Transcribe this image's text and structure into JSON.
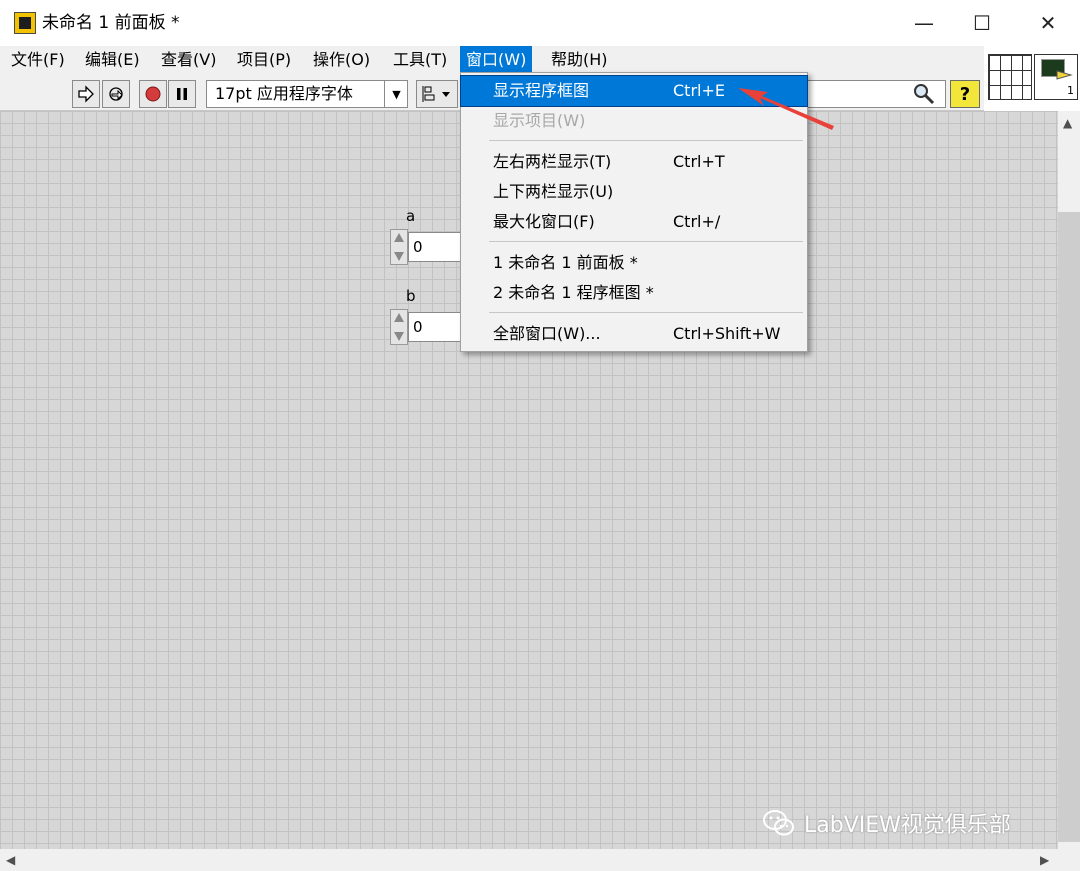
{
  "window": {
    "title": "未命名 1 前面板 *",
    "minimize_glyph": "—",
    "maximize_glyph": "☐",
    "close_glyph": "✕"
  },
  "menubar": {
    "items": [
      {
        "label": "文件(F)"
      },
      {
        "label": "编辑(E)"
      },
      {
        "label": "查看(V)"
      },
      {
        "label": "项目(P)"
      },
      {
        "label": "操作(O)"
      },
      {
        "label": "工具(T)"
      },
      {
        "label": "窗口(W)",
        "active": true
      },
      {
        "label": "帮助(H)"
      }
    ]
  },
  "toolbar": {
    "font_label": "17pt 应用程序字体",
    "help_glyph": "?"
  },
  "window_menu": {
    "items": [
      {
        "label": "显示程序框图",
        "shortcut": "Ctrl+E",
        "state": "highlighted"
      },
      {
        "label": "显示项目(W)",
        "shortcut": "",
        "state": "disabled"
      },
      {
        "label": "左右两栏显示(T)",
        "shortcut": "Ctrl+T",
        "state": "normal"
      },
      {
        "label": "上下两栏显示(U)",
        "shortcut": "",
        "state": "normal"
      },
      {
        "label": "最大化窗口(F)",
        "shortcut": "Ctrl+/",
        "state": "normal"
      },
      {
        "label": "1 未命名 1 前面板 *",
        "shortcut": "",
        "state": "normal"
      },
      {
        "label": "2 未命名 1 程序框图 *",
        "shortcut": "",
        "state": "normal"
      },
      {
        "label": "全部窗口(W)...",
        "shortcut": "Ctrl+Shift+W",
        "state": "normal"
      }
    ]
  },
  "controls": [
    {
      "label": "a",
      "value": "0"
    },
    {
      "label": "b",
      "value": "0"
    }
  ],
  "vi_icon": {
    "number": "1"
  },
  "watermark": {
    "text": "LabVIEW视觉俱乐部"
  },
  "colors": {
    "menu_highlight": "#0078d7",
    "annotation_arrow": "#e8413a",
    "help_button": "#f3e63a"
  }
}
